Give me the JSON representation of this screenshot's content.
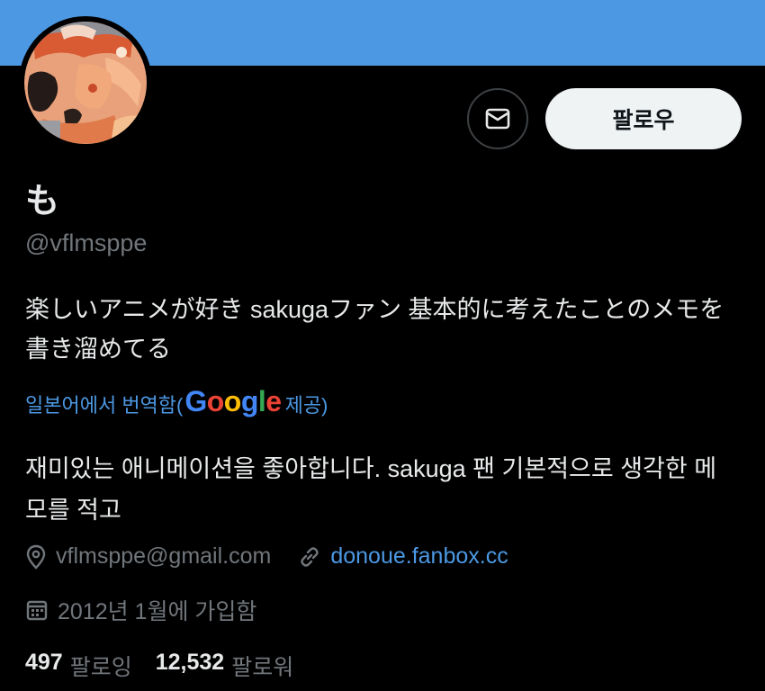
{
  "banner": {
    "color": "#4c98e3"
  },
  "profile": {
    "display_name": "も",
    "handle": "@vflmsppe",
    "bio": "楽しいアニメが好き sakugaファン 基本的に考えたことのメモを書き溜めてる",
    "translation": {
      "prefix": "일본어에서 번역함(",
      "provider_g": "G",
      "provider_o1": "o",
      "provider_o2": "o",
      "provider_g2": "g",
      "provider_l": "l",
      "provider_e": "e",
      "suffix": " 제공)",
      "text": "재미있는 애니메이션을 좋아합니다. sakuga 팬 기본적으로 생각한 메모를 적고"
    },
    "location": "vflmsppe@gmail.com",
    "website": "donoue.fanbox.cc",
    "joined": "2012년 1월에 가입함",
    "following_count": "497",
    "following_label": "팔로잉",
    "followers_count": "12,532",
    "followers_label": "팔로워"
  },
  "actions": {
    "message_icon": "envelope-icon",
    "follow_label": "팔로우"
  },
  "icons": {
    "location": "location-pin-icon",
    "link": "link-icon",
    "calendar": "calendar-icon"
  },
  "colors": {
    "accent": "#4c98e3",
    "muted": "#71767b",
    "text": "#e7e9ea",
    "background": "#000000",
    "google_blue": "#4285f4",
    "google_red": "#ea4335",
    "google_yellow": "#fbbc05",
    "google_green": "#34a853"
  }
}
